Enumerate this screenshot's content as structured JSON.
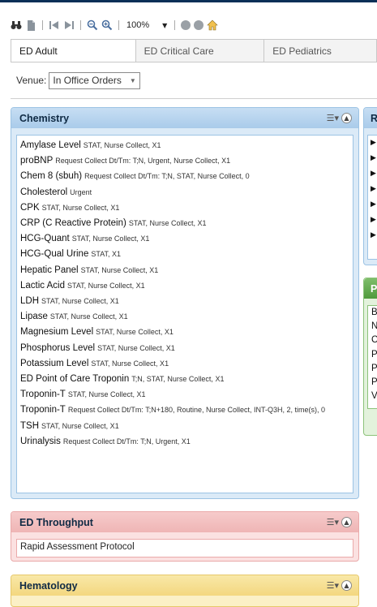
{
  "toolbar": {
    "zoom": "100%",
    "icons": [
      "binoculars-icon",
      "document-icon",
      "back-icon",
      "forward-icon",
      "zoom-out-icon",
      "zoom-in-icon",
      "circle-icon",
      "circle-icon",
      "home-icon"
    ]
  },
  "tabs": [
    {
      "label": "ED Adult"
    },
    {
      "label": "ED Critical Care"
    },
    {
      "label": "ED Pediatrics"
    }
  ],
  "venue": {
    "label": "Venue:",
    "value": "In Office Orders"
  },
  "chemistry": {
    "title": "Chemistry",
    "rows": [
      {
        "name": "Amylase Level",
        "detail": "STAT, Nurse Collect, X1"
      },
      {
        "name": "proBNP",
        "detail": "Request Collect Dt/Tm: T;N, Urgent, Nurse Collect, X1"
      },
      {
        "name": "Chem 8 (sbuh)",
        "detail": "Request Collect Dt/Tm: T;N, STAT, Nurse Collect, 0"
      },
      {
        "name": "Cholesterol",
        "detail": "Urgent"
      },
      {
        "name": "CPK",
        "detail": "STAT, Nurse Collect, X1"
      },
      {
        "name": "CRP (C Reactive Protein)",
        "detail": "STAT, Nurse Collect, X1"
      },
      {
        "name": "HCG-Quant",
        "detail": "STAT, Nurse Collect, X1"
      },
      {
        "name": "HCG-Qual Urine",
        "detail": "STAT, X1"
      },
      {
        "name": "Hepatic Panel",
        "detail": "STAT, Nurse Collect, X1"
      },
      {
        "name": "Lactic Acid",
        "detail": "STAT, Nurse Collect, X1"
      },
      {
        "name": "LDH",
        "detail": "STAT, Nurse Collect, X1"
      },
      {
        "name": "Lipase",
        "detail": "STAT, Nurse Collect, X1"
      },
      {
        "name": "Magnesium Level",
        "detail": "STAT, Nurse Collect, X1"
      },
      {
        "name": "Phosphorus Level",
        "detail": "STAT, Nurse Collect, X1"
      },
      {
        "name": "Potassium Level",
        "detail": "STAT, Nurse Collect, X1"
      },
      {
        "name": "ED Point of Care Troponin",
        "detail": "T;N, STAT, Nurse Collect, X1"
      },
      {
        "name": "Troponin-T",
        "detail": "STAT, Nurse Collect, X1"
      },
      {
        "name": "Troponin-T",
        "detail": "Request Collect Dt/Tm: T;N+180, Routine, Nurse Collect, INT-Q3H, 2, time(s), 0"
      },
      {
        "name": "TSH",
        "detail": "STAT, Nurse Collect, X1"
      },
      {
        "name": "Urinalysis",
        "detail": "Request Collect Dt/Tm: T;N, Urgent, X1"
      }
    ]
  },
  "throughput": {
    "title": "ED Throughput",
    "rows": [
      "Rapid Assessment Protocol"
    ]
  },
  "hematology": {
    "title": "Hematology"
  },
  "right_panel_1": {
    "title_fragment": "R",
    "row_count_markers": [
      "▶",
      "▶",
      "▶",
      "▶",
      "▶",
      "▶",
      "▶"
    ]
  },
  "right_panel_2": {
    "title_fragment": "P",
    "letters": [
      "B",
      "N",
      "C",
      "P",
      "P",
      "P",
      "V"
    ]
  }
}
